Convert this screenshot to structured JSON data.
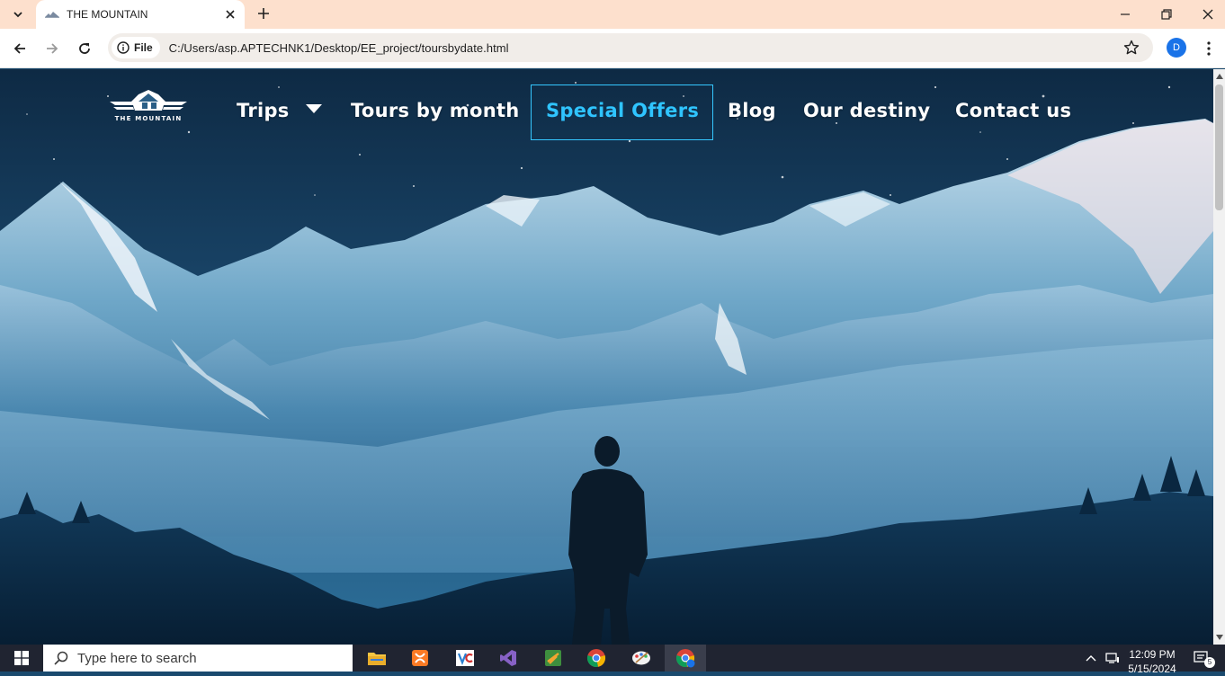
{
  "browser": {
    "tab_title": "THE MOUNTAIN",
    "site_info_label": "File",
    "url": "C:/Users/asp.APTECHNK1/Desktop/EE_project/toursbydate.html",
    "profile_initial": "D"
  },
  "site": {
    "logo_text": "THE MOUNTAIN",
    "nav": [
      {
        "label": "Trips",
        "has_dropdown": true
      },
      {
        "label": "Tours by month"
      },
      {
        "label": "Special Offers",
        "active": true
      },
      {
        "label": "Blog"
      },
      {
        "label": "Our destiny"
      },
      {
        "label": "Contact us"
      }
    ],
    "colors": {
      "active": "#2fc4ff",
      "nav_text": "#ffffff"
    }
  },
  "taskbar": {
    "search_placeholder": "Type here to search",
    "time": "12:09 PM",
    "date": "5/15/2024",
    "notifications": "5",
    "apps": [
      "file-explorer",
      "xampp",
      "vs-code",
      "visual-studio",
      "sublime-text",
      "chrome",
      "paint",
      "chrome-profile"
    ]
  }
}
